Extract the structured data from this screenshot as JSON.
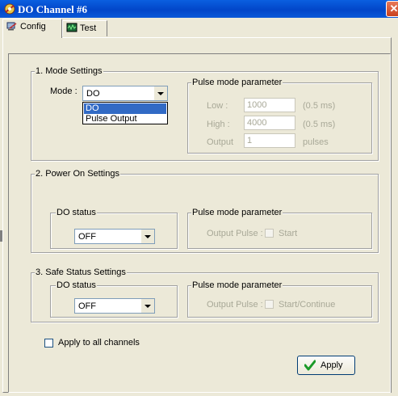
{
  "window": {
    "title": "DO Channel #6",
    "close_glyph": "✕"
  },
  "tabs": [
    {
      "label": "Config",
      "icon": "config-tab-icon",
      "active": true
    },
    {
      "label": "Test",
      "icon": "test-tab-icon",
      "active": false
    }
  ],
  "mode_settings": {
    "title": "1. Mode Settings",
    "mode_label": "Mode :",
    "mode_value": "DO",
    "dropdown_options": [
      "DO",
      "Pulse Output"
    ],
    "pulse": {
      "title": "Pulse mode parameter",
      "low_label": "Low :",
      "low_value": "1000",
      "low_unit": "(0.5 ms)",
      "high_label": "High :",
      "high_value": "4000",
      "high_unit": "(0.5 ms)",
      "output_label": "Output",
      "output_value": "1",
      "output_unit": "pulses"
    }
  },
  "power_on": {
    "title": "2. Power On Settings",
    "do_status_label": "DO status",
    "do_status_value": "OFF",
    "pulse_title": "Pulse mode parameter",
    "output_pulse_label": "Output Pulse :",
    "start_label": "Start"
  },
  "safe_status": {
    "title": "3. Safe Status Settings",
    "do_status_label": "DO status",
    "do_status_value": "OFF",
    "pulse_title": "Pulse mode parameter",
    "output_pulse_label": "Output Pulse :",
    "start_label": "Start/Continue"
  },
  "apply_all_label": "Apply to all channels",
  "apply_button": "Apply",
  "colors": {
    "titlebar": "#0246c9",
    "dialog_bg": "#ece9d8",
    "selection": "#316ac5",
    "disabled_text": "#a8a897"
  }
}
